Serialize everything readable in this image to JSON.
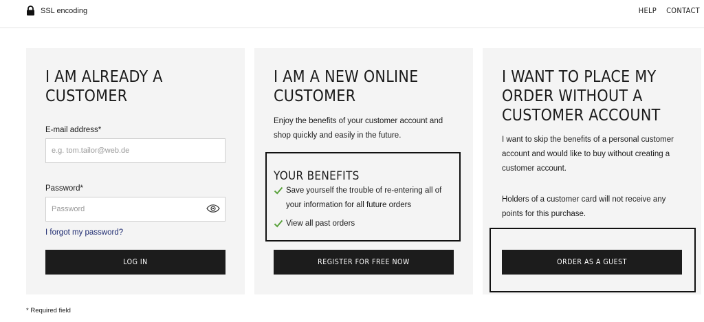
{
  "header": {
    "ssl_label": "SSL encoding",
    "lock_icon": "lock-icon",
    "help": "HELP",
    "contact": "CONTACT"
  },
  "existing_customer": {
    "title": "I AM ALREADY A CUSTOMER",
    "email_label": "E-mail address*",
    "email_placeholder": "e.g. tom.tailor@web.de",
    "email_value": "",
    "password_label": "Password*",
    "password_placeholder": "Password",
    "password_value": "",
    "eye_icon": "eye-icon",
    "forgot_link": "I forgot my password?",
    "login_button": "LOG IN"
  },
  "new_customer": {
    "title": "I AM A NEW ONLINE CUSTOMER",
    "description": "Enjoy the benefits of your customer account and shop quickly and easily in the future.",
    "benefits_title": "YOUR BENEFITS",
    "benefits": [
      "Save yourself the trouble of re-entering all of your information for all future orders",
      "View all past orders"
    ],
    "check_icon": "checkmark-icon",
    "check_color": "#5aa23c",
    "register_button": "REGISTER FOR FREE NOW"
  },
  "guest": {
    "title": "I WANT TO PLACE MY ORDER WITHOUT A CUSTOMER ACCOUNT",
    "description": "I want to skip the benefits of a personal customer account and would like to buy without creating a customer account.",
    "note": "Holders of a customer card will not receive any points for this purchase.",
    "guest_button": "ORDER AS A GUEST"
  },
  "footer": {
    "required_note": "* Required field"
  },
  "colors": {
    "card_background": "#f4f4f4",
    "button_background": "#1c1c1c",
    "link": "#1d2a70"
  }
}
